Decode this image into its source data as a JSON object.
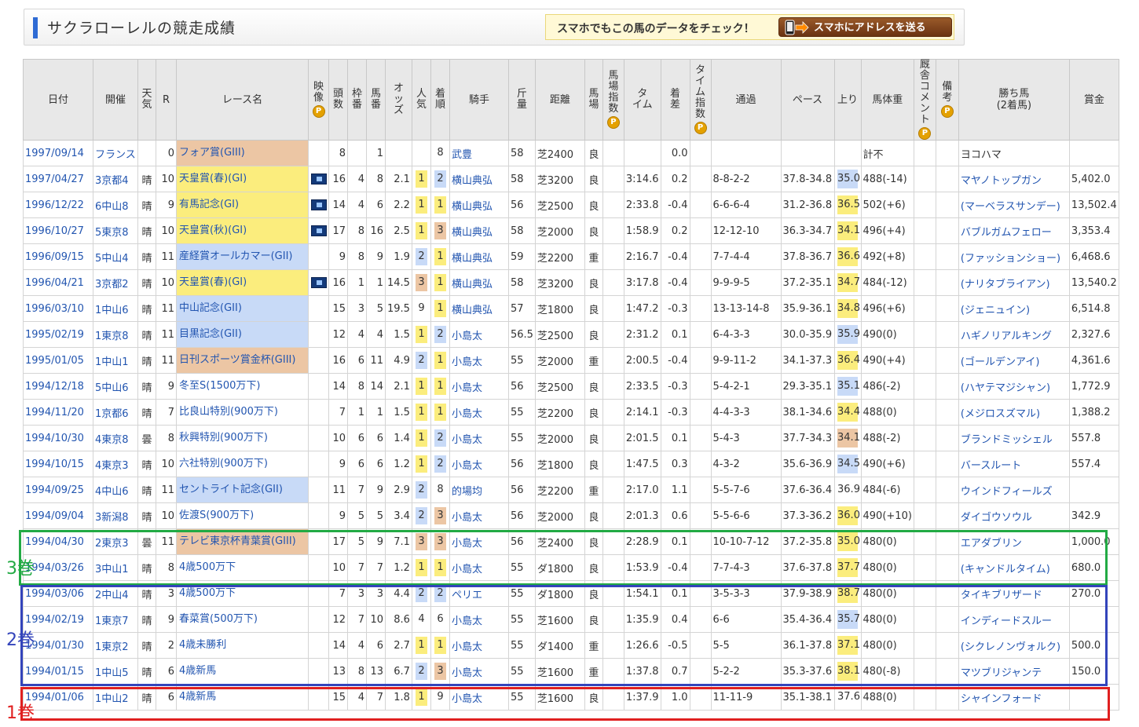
{
  "header": {
    "title": "サクラローレルの競走成績",
    "promo_text": "スマホでもこの馬のデータをチェック！",
    "send_button": "スマホにアドレスを送る"
  },
  "columns": [
    "日付",
    "開催",
    "天気",
    "R",
    "レース名",
    "映像",
    "頭数",
    "枠番",
    "馬番",
    "オッズ",
    "人気",
    "着順",
    "騎手",
    "斤量",
    "距離",
    "馬場",
    "馬場指数",
    "タイム",
    "着差",
    "タイム指数",
    "通過",
    "ペース",
    "上り",
    "馬体重",
    "厩舎コメント",
    "備考",
    "勝ち馬(2着馬)",
    "賞金"
  ],
  "header_labels": {
    "date": "日付",
    "venue": "開催",
    "weather": "天気",
    "r": "R",
    "race": "レース名",
    "video": "映像",
    "heads": "頭数",
    "waku": "枠番",
    "umaban": "馬番",
    "odds": "オッズ",
    "pop": "人気",
    "rank": "着順",
    "jockey": "騎手",
    "weight": "斤量",
    "dist": "距離",
    "track": "馬場",
    "track_idx": "馬場指数",
    "time": "タイム",
    "margin": "着差",
    "time_idx": "タイム指数",
    "passing": "通過",
    "pace": "ペース",
    "last": "上り",
    "body": "馬体重",
    "comment": "厩舎コメント",
    "note": "備考",
    "winner": "勝ち馬",
    "winner2": "(2着馬)",
    "prize": "賞金"
  },
  "p_icon_label": "P",
  "rows": [
    {
      "date": "1997/09/14",
      "venue": "フランス",
      "weather": "",
      "r": "0",
      "race": "フォア賞(GIII)",
      "grade": "g3",
      "video": false,
      "heads": "8",
      "waku": "",
      "umaban": "1",
      "odds": "",
      "pop": "",
      "pop_c": "",
      "rank": "8",
      "rank_c": "",
      "jockey": "武豊",
      "weight": "58",
      "dist": "芝2400",
      "track": "良",
      "time": "",
      "margin": "0.0",
      "passing": "",
      "pace": "",
      "last": "",
      "last_c": "",
      "body": "計不",
      "winner": "ヨコハマ",
      "winner_link": false,
      "prize": ""
    },
    {
      "date": "1997/04/27",
      "venue": "3京都4",
      "weather": "晴",
      "r": "10",
      "race": "天皇賞(春)(GI)",
      "grade": "g1",
      "video": true,
      "heads": "16",
      "waku": "4",
      "umaban": "8",
      "odds": "2.1",
      "pop": "1",
      "pop_c": "g1",
      "rank": "2",
      "rank_c": "g2",
      "jockey": "横山典弘",
      "weight": "58",
      "dist": "芝3200",
      "track": "良",
      "time": "3:14.6",
      "margin": "0.2",
      "passing": "8-8-2-2",
      "pace": "37.8-34.8",
      "last": "35.0",
      "last_c": "g2",
      "body": "488(-14)",
      "winner": "マヤノトップガン",
      "winner_link": true,
      "prize": "5,402.0"
    },
    {
      "date": "1996/12/22",
      "venue": "6中山8",
      "weather": "晴",
      "r": "9",
      "race": "有馬記念(GI)",
      "grade": "g1",
      "video": true,
      "heads": "14",
      "waku": "4",
      "umaban": "6",
      "odds": "2.2",
      "pop": "1",
      "pop_c": "g1",
      "rank": "1",
      "rank_c": "g1",
      "jockey": "横山典弘",
      "weight": "56",
      "dist": "芝2500",
      "track": "良",
      "time": "2:33.8",
      "margin": "-0.4",
      "passing": "6-6-6-4",
      "pace": "31.2-36.8",
      "last": "36.5",
      "last_c": "g1",
      "body": "502(+6)",
      "winner": "(マーベラスサンデー)",
      "winner_link": true,
      "prize": "13,502.4"
    },
    {
      "date": "1996/10/27",
      "venue": "5東京8",
      "weather": "晴",
      "r": "10",
      "race": "天皇賞(秋)(GI)",
      "grade": "g1",
      "video": true,
      "heads": "17",
      "waku": "8",
      "umaban": "16",
      "odds": "2.5",
      "pop": "1",
      "pop_c": "g1",
      "rank": "3",
      "rank_c": "g3",
      "jockey": "横山典弘",
      "weight": "58",
      "dist": "芝2000",
      "track": "良",
      "time": "1:58.9",
      "margin": "0.2",
      "passing": "12-12-10",
      "pace": "36.3-34.7",
      "last": "34.1",
      "last_c": "g1",
      "body": "496(+4)",
      "winner": "バブルガムフェロー",
      "winner_link": true,
      "prize": "3,353.4"
    },
    {
      "date": "1996/09/15",
      "venue": "5中山4",
      "weather": "晴",
      "r": "11",
      "race": "産経賞オールカマー(GII)",
      "grade": "g2",
      "video": false,
      "heads": "9",
      "waku": "8",
      "umaban": "9",
      "odds": "1.9",
      "pop": "2",
      "pop_c": "g2",
      "rank": "1",
      "rank_c": "g1",
      "jockey": "横山典弘",
      "weight": "59",
      "dist": "芝2200",
      "track": "重",
      "time": "2:16.7",
      "margin": "-0.4",
      "passing": "7-7-4-4",
      "pace": "37.8-36.7",
      "last": "36.6",
      "last_c": "g1",
      "body": "492(+8)",
      "winner": "(ファッションショー)",
      "winner_link": true,
      "prize": "6,468.6"
    },
    {
      "date": "1996/04/21",
      "venue": "3京都2",
      "weather": "晴",
      "r": "10",
      "race": "天皇賞(春)(GI)",
      "grade": "g1",
      "video": true,
      "heads": "16",
      "waku": "1",
      "umaban": "1",
      "odds": "14.5",
      "pop": "3",
      "pop_c": "g3",
      "rank": "1",
      "rank_c": "g1",
      "jockey": "横山典弘",
      "weight": "58",
      "dist": "芝3200",
      "track": "良",
      "time": "3:17.8",
      "margin": "-0.4",
      "passing": "9-9-9-5",
      "pace": "37.2-35.1",
      "last": "34.7",
      "last_c": "g1",
      "body": "484(-12)",
      "winner": "(ナリタブライアン)",
      "winner_link": true,
      "prize": "13,540.2"
    },
    {
      "date": "1996/03/10",
      "venue": "1中山6",
      "weather": "晴",
      "r": "11",
      "race": "中山記念(GII)",
      "grade": "g2",
      "video": false,
      "heads": "15",
      "waku": "3",
      "umaban": "5",
      "odds": "19.5",
      "pop": "9",
      "pop_c": "",
      "rank": "1",
      "rank_c": "g1",
      "jockey": "横山典弘",
      "weight": "57",
      "dist": "芝1800",
      "track": "良",
      "time": "1:47.2",
      "margin": "-0.3",
      "passing": "13-13-14-8",
      "pace": "35.9-36.1",
      "last": "34.8",
      "last_c": "g1",
      "body": "496(+6)",
      "winner": "(ジェニュイン)",
      "winner_link": true,
      "prize": "6,514.8"
    },
    {
      "date": "1995/02/19",
      "venue": "1東京8",
      "weather": "晴",
      "r": "11",
      "race": "目黒記念(GII)",
      "grade": "g2",
      "video": false,
      "heads": "12",
      "waku": "4",
      "umaban": "4",
      "odds": "1.5",
      "pop": "1",
      "pop_c": "g1",
      "rank": "2",
      "rank_c": "g2",
      "jockey": "小島太",
      "weight": "56.5",
      "dist": "芝2500",
      "track": "良",
      "time": "2:31.2",
      "margin": "0.1",
      "passing": "6-4-3-3",
      "pace": "30.0-35.9",
      "last": "35.9",
      "last_c": "g2",
      "body": "490(0)",
      "winner": "ハギノリアルキング",
      "winner_link": true,
      "prize": "2,327.6"
    },
    {
      "date": "1995/01/05",
      "venue": "1中山1",
      "weather": "晴",
      "r": "11",
      "race": "日刊スポーツ賞金杯(GIII)",
      "grade": "g3",
      "video": false,
      "heads": "16",
      "waku": "6",
      "umaban": "11",
      "odds": "4.9",
      "pop": "2",
      "pop_c": "g2",
      "rank": "1",
      "rank_c": "g1",
      "jockey": "小島太",
      "weight": "55",
      "dist": "芝2000",
      "track": "重",
      "time": "2:00.5",
      "margin": "-0.4",
      "passing": "9-9-11-2",
      "pace": "34.1-37.3",
      "last": "36.4",
      "last_c": "g1",
      "body": "490(+4)",
      "winner": "(ゴールデンアイ)",
      "winner_link": true,
      "prize": "4,361.6"
    },
    {
      "date": "1994/12/18",
      "venue": "5中山6",
      "weather": "晴",
      "r": "9",
      "race": "冬至S(1500万下)",
      "grade": "",
      "video": false,
      "heads": "14",
      "waku": "8",
      "umaban": "14",
      "odds": "2.1",
      "pop": "1",
      "pop_c": "g1",
      "rank": "1",
      "rank_c": "g1",
      "jockey": "小島太",
      "weight": "56",
      "dist": "芝2500",
      "track": "良",
      "time": "2:33.5",
      "margin": "-0.3",
      "passing": "5-4-2-1",
      "pace": "29.3-35.1",
      "last": "35.1",
      "last_c": "g2",
      "body": "486(-2)",
      "winner": "(ハヤテマジシャン)",
      "winner_link": true,
      "prize": "1,772.9"
    },
    {
      "date": "1994/11/20",
      "venue": "1京都6",
      "weather": "晴",
      "r": "7",
      "race": "比良山特別(900万下)",
      "grade": "",
      "video": false,
      "heads": "7",
      "waku": "1",
      "umaban": "1",
      "odds": "1.5",
      "pop": "1",
      "pop_c": "g1",
      "rank": "1",
      "rank_c": "g1",
      "jockey": "小島太",
      "weight": "55",
      "dist": "芝2200",
      "track": "良",
      "time": "2:14.1",
      "margin": "-0.3",
      "passing": "4-4-3-3",
      "pace": "38.1-34.6",
      "last": "34.4",
      "last_c": "g1",
      "body": "488(0)",
      "winner": "(メジロスズマル)",
      "winner_link": true,
      "prize": "1,388.2"
    },
    {
      "date": "1994/10/30",
      "venue": "4東京8",
      "weather": "曇",
      "r": "8",
      "race": "秋興特別(900万下)",
      "grade": "",
      "video": false,
      "heads": "10",
      "waku": "6",
      "umaban": "6",
      "odds": "1.4",
      "pop": "1",
      "pop_c": "g1",
      "rank": "2",
      "rank_c": "g2",
      "jockey": "小島太",
      "weight": "55",
      "dist": "芝2000",
      "track": "良",
      "time": "2:01.5",
      "margin": "0.1",
      "passing": "5-4-3",
      "pace": "37.7-34.3",
      "last": "34.1",
      "last_c": "g3",
      "body": "488(-2)",
      "winner": "ブランドミッシェル",
      "winner_link": true,
      "prize": "557.8"
    },
    {
      "date": "1994/10/15",
      "venue": "4東京3",
      "weather": "晴",
      "r": "10",
      "race": "六社特別(900万下)",
      "grade": "",
      "video": false,
      "heads": "9",
      "waku": "6",
      "umaban": "6",
      "odds": "1.2",
      "pop": "1",
      "pop_c": "g1",
      "rank": "2",
      "rank_c": "g2",
      "jockey": "小島太",
      "weight": "56",
      "dist": "芝1800",
      "track": "良",
      "time": "1:47.5",
      "margin": "0.3",
      "passing": "4-3-2",
      "pace": "35.6-36.9",
      "last": "34.5",
      "last_c": "g2",
      "body": "490(+6)",
      "winner": "バースルート",
      "winner_link": true,
      "prize": "557.4"
    },
    {
      "date": "1994/09/25",
      "venue": "4中山6",
      "weather": "晴",
      "r": "11",
      "race": "セントライト記念(GII)",
      "grade": "g2",
      "video": false,
      "heads": "11",
      "waku": "7",
      "umaban": "9",
      "odds": "2.9",
      "pop": "2",
      "pop_c": "g2",
      "rank": "8",
      "rank_c": "",
      "jockey": "的場均",
      "weight": "56",
      "dist": "芝2200",
      "track": "重",
      "time": "2:17.0",
      "margin": "1.1",
      "passing": "5-5-7-6",
      "pace": "37.6-36.4",
      "last": "36.9",
      "last_c": "",
      "body": "484(-6)",
      "winner": "ウインドフィールズ",
      "winner_link": true,
      "prize": ""
    },
    {
      "date": "1994/09/04",
      "venue": "3新潟8",
      "weather": "晴",
      "r": "10",
      "race": "佐渡S(900万下)",
      "grade": "",
      "video": false,
      "heads": "9",
      "waku": "5",
      "umaban": "5",
      "odds": "3.4",
      "pop": "2",
      "pop_c": "g2",
      "rank": "3",
      "rank_c": "g3",
      "jockey": "小島太",
      "weight": "56",
      "dist": "芝2000",
      "track": "良",
      "time": "2:01.3",
      "margin": "0.6",
      "passing": "5-5-6-6",
      "pace": "37.3-36.2",
      "last": "36.0",
      "last_c": "g1",
      "body": "490(+10)",
      "winner": "ダイゴウソウル",
      "winner_link": true,
      "prize": "342.9"
    },
    {
      "date": "1994/04/30",
      "venue": "2東京3",
      "weather": "曇",
      "r": "11",
      "race": "テレビ東京杯青葉賞(GIII)",
      "grade": "g3",
      "video": false,
      "heads": "17",
      "waku": "5",
      "umaban": "9",
      "odds": "7.1",
      "pop": "3",
      "pop_c": "g3",
      "rank": "3",
      "rank_c": "g3",
      "jockey": "小島太",
      "weight": "56",
      "dist": "芝2400",
      "track": "良",
      "time": "2:28.9",
      "margin": "0.1",
      "passing": "10-10-7-12",
      "pace": "37.2-35.8",
      "last": "35.0",
      "last_c": "g1",
      "body": "480(0)",
      "winner": "エアダブリン",
      "winner_link": true,
      "prize": "1,000.0"
    },
    {
      "date": "1994/03/26",
      "venue": "3中山1",
      "weather": "晴",
      "r": "8",
      "race": "4歳500万下",
      "grade": "",
      "video": false,
      "heads": "10",
      "waku": "7",
      "umaban": "7",
      "odds": "1.2",
      "pop": "1",
      "pop_c": "g1",
      "rank": "1",
      "rank_c": "g1",
      "jockey": "小島太",
      "weight": "55",
      "dist": "ダ1800",
      "track": "良",
      "time": "1:53.9",
      "margin": "-0.4",
      "passing": "7-7-4-3",
      "pace": "37.6-37.8",
      "last": "37.7",
      "last_c": "g1",
      "body": "480(0)",
      "winner": "(キャンドルタイム)",
      "winner_link": true,
      "prize": "680.0"
    },
    {
      "date": "1994/03/06",
      "venue": "2中山4",
      "weather": "晴",
      "r": "3",
      "race": "4歳500万下",
      "grade": "",
      "video": false,
      "heads": "7",
      "waku": "3",
      "umaban": "3",
      "odds": "4.4",
      "pop": "2",
      "pop_c": "g2",
      "rank": "2",
      "rank_c": "g2",
      "jockey": "ペリエ",
      "weight": "55",
      "dist": "ダ1800",
      "track": "良",
      "time": "1:54.1",
      "margin": "0.1",
      "passing": "3-5-3-3",
      "pace": "37.9-38.9",
      "last": "38.7",
      "last_c": "g1",
      "body": "480(0)",
      "winner": "タイキブリザード",
      "winner_link": true,
      "prize": "270.0"
    },
    {
      "date": "1994/02/19",
      "venue": "1東京7",
      "weather": "晴",
      "r": "9",
      "race": "春菜賞(500万下)",
      "grade": "",
      "video": false,
      "heads": "12",
      "waku": "7",
      "umaban": "10",
      "odds": "8.6",
      "pop": "4",
      "pop_c": "",
      "rank": "6",
      "rank_c": "",
      "jockey": "小島太",
      "weight": "55",
      "dist": "芝1600",
      "track": "良",
      "time": "1:35.9",
      "margin": "0.4",
      "passing": "6-6",
      "pace": "35.4-36.4",
      "last": "35.7",
      "last_c": "g2",
      "body": "480(0)",
      "winner": "インディードスルー",
      "winner_link": true,
      "prize": ""
    },
    {
      "date": "1994/01/30",
      "venue": "1東京2",
      "weather": "晴",
      "r": "2",
      "race": "4歳未勝利",
      "grade": "",
      "video": false,
      "heads": "14",
      "waku": "4",
      "umaban": "6",
      "odds": "2.7",
      "pop": "1",
      "pop_c": "g1",
      "rank": "1",
      "rank_c": "g1",
      "jockey": "小島太",
      "weight": "55",
      "dist": "ダ1400",
      "track": "重",
      "time": "1:26.6",
      "margin": "-0.5",
      "passing": "5-5",
      "pace": "36.1-37.8",
      "last": "37.1",
      "last_c": "g1",
      "body": "480(0)",
      "winner": "(シクレノンヴォルク)",
      "winner_link": true,
      "prize": "500.0"
    },
    {
      "date": "1994/01/15",
      "venue": "1中山5",
      "weather": "晴",
      "r": "6",
      "race": "4歳新馬",
      "grade": "",
      "video": false,
      "heads": "13",
      "waku": "8",
      "umaban": "13",
      "odds": "6.7",
      "pop": "2",
      "pop_c": "g2",
      "rank": "3",
      "rank_c": "g3",
      "jockey": "小島太",
      "weight": "55",
      "dist": "芝1600",
      "track": "重",
      "time": "1:37.8",
      "margin": "0.7",
      "passing": "5-2-2",
      "pace": "35.3-37.6",
      "last": "38.1",
      "last_c": "g1",
      "body": "480(-8)",
      "winner": "マツブリジャンテ",
      "winner_link": true,
      "prize": "150.0"
    },
    {
      "date": "1994/01/06",
      "venue": "1中山2",
      "weather": "晴",
      "r": "6",
      "race": "4歳新馬",
      "grade": "",
      "video": false,
      "heads": "15",
      "waku": "4",
      "umaban": "7",
      "odds": "1.8",
      "pop": "1",
      "pop_c": "g1",
      "rank": "9",
      "rank_c": "",
      "jockey": "小島太",
      "weight": "55",
      "dist": "芝1600",
      "track": "良",
      "time": "1:37.9",
      "margin": "1.0",
      "passing": "11-11-9",
      "pace": "35.1-38.1",
      "last": "37.6",
      "last_c": "",
      "body": "488(0)",
      "winner": "シャインフォード",
      "winner_link": true,
      "prize": ""
    }
  ],
  "annotations": [
    {
      "label": "3巻",
      "color": "#22aa44"
    },
    {
      "label": "2巻",
      "color": "#3344bb"
    },
    {
      "label": "1巻",
      "color": "#e02020"
    }
  ]
}
